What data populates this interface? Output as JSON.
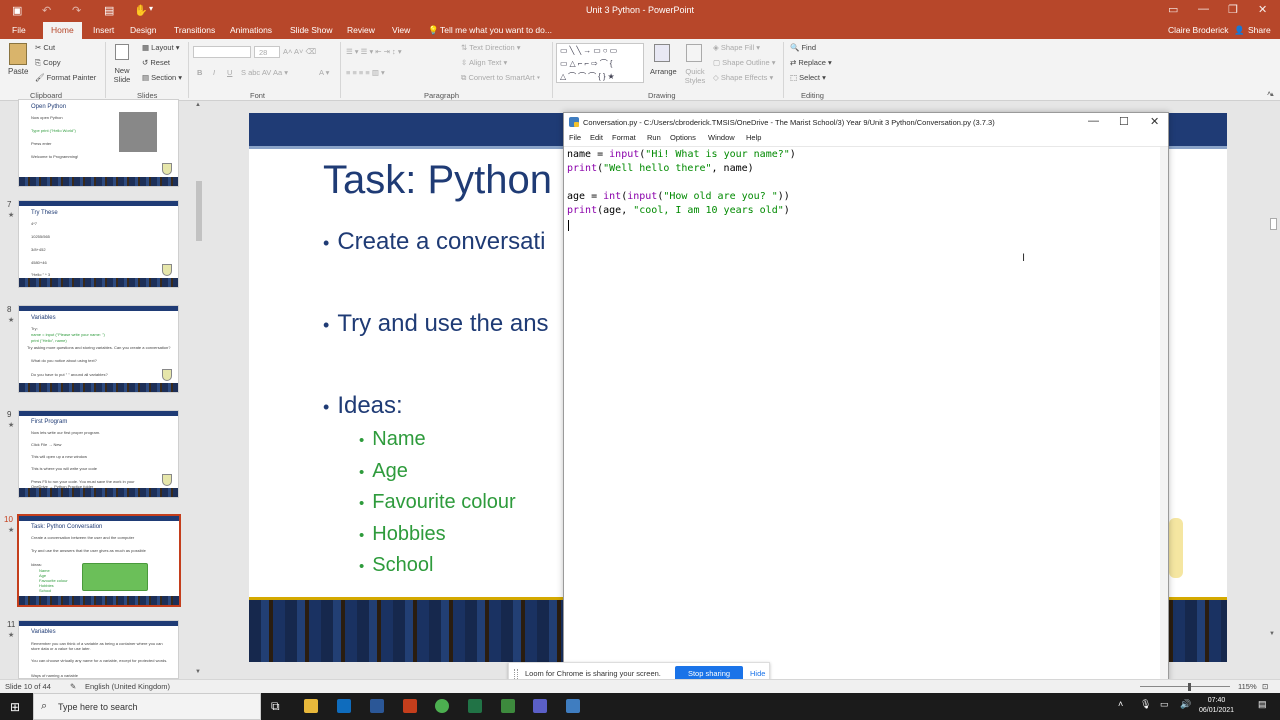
{
  "window": {
    "title": "Unit 3 Python - PowerPoint",
    "user": "Claire Broderick",
    "share": "Share"
  },
  "tabs": [
    "File",
    "Home",
    "Insert",
    "Design",
    "Transitions",
    "Animations",
    "Slide Show",
    "Review",
    "View"
  ],
  "tell_me": "Tell me what you want to do...",
  "ribbon": {
    "clipboard": {
      "paste": "Paste",
      "cut": "Cut",
      "copy": "Copy",
      "format_painter": "Format Painter",
      "group": "Clipboard"
    },
    "slides": {
      "new_slide": "New Slide",
      "layout": "Layout",
      "reset": "Reset",
      "section": "Section",
      "group": "Slides"
    },
    "font": {
      "size": "28",
      "group": "Font"
    },
    "paragraph": {
      "text_direction": "Text Direction",
      "align_text": "Align Text",
      "convert_smartart": "Convert to SmartArt",
      "group": "Paragraph"
    },
    "drawing": {
      "arrange": "Arrange",
      "quick_styles": "Quick Styles",
      "shape_fill": "Shape Fill",
      "shape_outline": "Shape Outline",
      "shape_effects": "Shape Effects",
      "group": "Drawing"
    },
    "editing": {
      "find": "Find",
      "replace": "Replace",
      "select": "Select",
      "group": "Editing"
    }
  },
  "thumbnails": [
    {
      "num": "",
      "title": "Open Python",
      "lines": [
        "Now open Python",
        "Type print (\"Hello World\")",
        "Press enter",
        "Welcome to Programming!"
      ]
    },
    {
      "num": "7",
      "title": "Try These",
      "lines": [
        "4*7",
        "10255/565",
        "3/8+452",
        "4580+46",
        "\"Hello \" * 3"
      ]
    },
    {
      "num": "8",
      "title": "Variables",
      "lines": [
        "Try:",
        "name = input (\"Please write your name: \")",
        "print (\"Hello\", name)",
        "Try asking more questions and storing variables. Can you create a conversation?",
        "What do you notice about using text?",
        "Do you have to put \" \" around all variables?"
      ]
    },
    {
      "num": "9",
      "title": "First Program",
      "lines": [
        "Now lets write our first proper program.",
        "Click File → New",
        "This will open up a new window",
        "This is where you will write your code",
        "Press F5 to run your code. You must save the work in your OneDrive → Python Practice folder"
      ]
    },
    {
      "num": "10",
      "title": "Task: Python Conversation",
      "lines": [
        "Create a conversation between the user and the computer",
        "Try and use the answers that the user gives as much as possible",
        "Ideas:",
        "Name",
        "Age",
        "Favourite colour",
        "Hobbies",
        "School"
      ]
    },
    {
      "num": "11",
      "title": "Variables",
      "lines": [
        "Remember you can think of a variable as being a container where you can store data or a value for use later.",
        "You can choose virtually any name for a variable, except for protected words.",
        "Ways of naming a variable"
      ]
    }
  ],
  "slide": {
    "title": "Task: Python",
    "bullets": [
      "Create a conversati",
      "Try and use the ans",
      "Ideas:"
    ],
    "ideas": [
      "Name",
      "Age",
      "Favourite colour",
      "Hobbies",
      "School"
    ]
  },
  "idle": {
    "title": "Conversation.py - C:/Users/cbroderick.TMSIS/OneDrive - The Marist School/3) Year 9/Unit 3 Python/Conversation.py (3.7.3)",
    "menu": [
      "File",
      "Edit",
      "Format",
      "Run",
      "Options",
      "Window",
      "Help"
    ],
    "code": [
      {
        "a": "name = ",
        "b": "input",
        "c": "(",
        "d": "\"Hi! What is your name?\"",
        "e": ")"
      },
      {
        "a": "",
        "b": "print",
        "c": "(",
        "d": "\"Well hello there\"",
        "e": ", name)"
      },
      {
        "a": "age = ",
        "b": "int",
        "c": "(",
        "d": "",
        "e": ""
      },
      {
        "a": "",
        "b": "print",
        "c": "(age, ",
        "d": "\"cool, I am 10 years old\"",
        "e": ")"
      }
    ],
    "code_line3_input": "input",
    "code_line3_str": "\"How old are you? \"",
    "code_line3_end": "))"
  },
  "loom": {
    "message": "Loom for Chrome is sharing your screen.",
    "stop": "Stop sharing",
    "hide": "Hide"
  },
  "status": {
    "slide_count": "Slide 10 of 44",
    "language": "English (United Kingdom)",
    "zoom": "115%"
  },
  "taskbar": {
    "search_placeholder": "Type here to search",
    "time": "07:40",
    "date": "06/01/2021"
  }
}
